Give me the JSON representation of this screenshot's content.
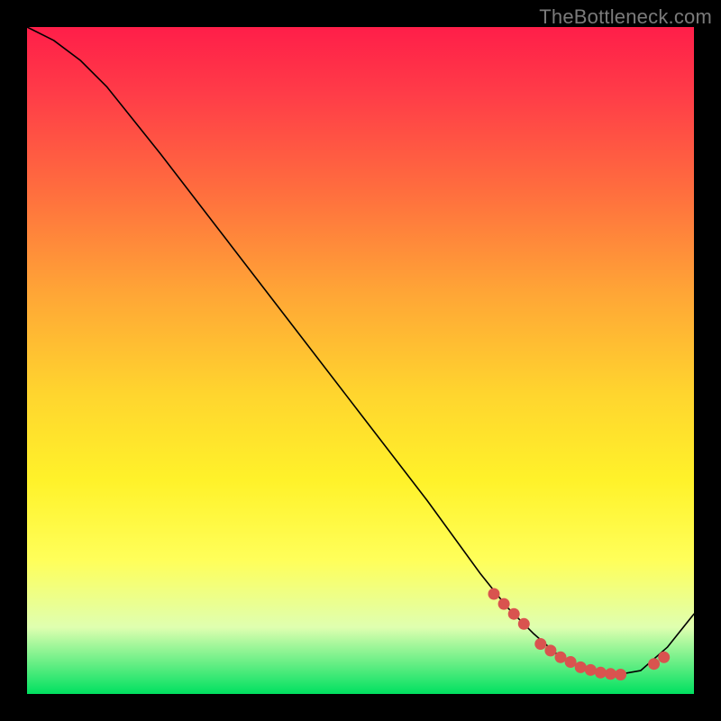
{
  "watermark": "TheBottleneck.com",
  "colors": {
    "bg": "#000000",
    "curve": "#000000",
    "marker": "#d9534f",
    "gradient_stops": [
      "#ff1e49",
      "#ff3c48",
      "#ff6f3e",
      "#ffa636",
      "#ffd52e",
      "#fff22a",
      "#ffff5a",
      "#dfffb0",
      "#00e060"
    ]
  },
  "chart_data": {
    "type": "line",
    "title": "",
    "xlabel": "",
    "ylabel": "",
    "xlim": [
      0,
      100
    ],
    "ylim": [
      0,
      100
    ],
    "note": "No axis ticks or numeric labels are rendered in the image; y-values here are proportional heights read from the curve (0 = bottom/green, 100 = top/red).",
    "series": [
      {
        "name": "curve",
        "x": [
          0,
          4,
          8,
          12,
          20,
          30,
          40,
          50,
          60,
          68,
          72,
          76,
          80,
          84,
          88,
          92,
          96,
          100
        ],
        "y": [
          100,
          98,
          95,
          91,
          81,
          68,
          55,
          42,
          29,
          18,
          13,
          9,
          5.5,
          3.5,
          2.8,
          3.5,
          7,
          12
        ]
      }
    ],
    "highlighted_points": {
      "comment": "Overlapping salmon dots near the trough of the curve",
      "x": [
        70,
        71.5,
        73,
        74.5,
        77,
        78.5,
        80,
        81.5,
        83,
        84.5,
        86,
        87.5,
        89,
        94,
        95.5
      ],
      "y": [
        15,
        13.5,
        12,
        10.5,
        7.5,
        6.5,
        5.5,
        4.8,
        4,
        3.6,
        3.2,
        3,
        2.9,
        4.5,
        5.5
      ]
    }
  }
}
